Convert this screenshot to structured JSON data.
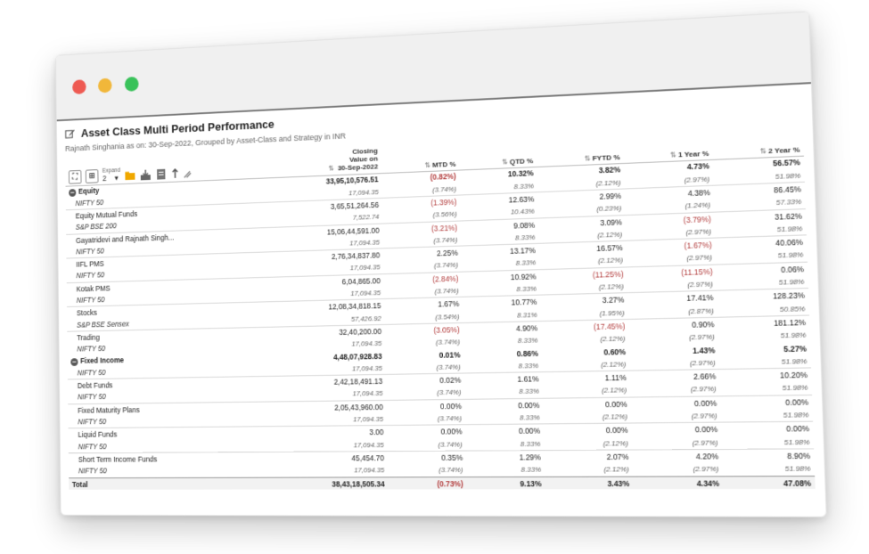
{
  "report": {
    "title": "Asset Class Multi Period Performance",
    "subtitle": "Rajnath Singhania as on: 30-Sep-2022, Grouped by Asset-Class and Strategy in INR"
  },
  "toolbar": {
    "expand_label": "Expand",
    "expand_value": "2"
  },
  "columns": {
    "closing": [
      "Closing",
      "Value on",
      "30-Sep-2022"
    ],
    "mtd": "MTD %",
    "qtd": "QTD %",
    "fytd": "FYTD %",
    "y1": "1 Year %",
    "y2": "2 Year %"
  },
  "rows": [
    {
      "kind": "group",
      "label": "Equity",
      "value": "33,95,10,576.51",
      "mtd": "(0.82%)",
      "qtd": "10.32%",
      "fytd": "3.82%",
      "y1": "4.73%",
      "y2": "56.57%"
    },
    {
      "kind": "bench",
      "label": "NIFTY 50",
      "value": "17,094.35",
      "mtd": "(3.74%)",
      "qtd": "8.33%",
      "fytd": "(2.12%)",
      "y1": "(2.97%)",
      "y2": "51.98%"
    },
    {
      "kind": "primary",
      "label": "Equity Mutual Funds",
      "value": "3,65,51,264.56",
      "mtd": "(1.39%)",
      "qtd": "12.63%",
      "fytd": "2.99%",
      "y1": "4.38%",
      "y2": "86.45%"
    },
    {
      "kind": "bench",
      "label": "S&P BSE 200",
      "value": "7,522.74",
      "mtd": "(3.56%)",
      "qtd": "10.43%",
      "fytd": "(0.23%)",
      "y1": "(1.24%)",
      "y2": "57.33%"
    },
    {
      "kind": "primary",
      "label": "Gayatridevi and Rajnath Singh...",
      "value": "15,06,44,591.00",
      "mtd": "(3.21%)",
      "qtd": "9.08%",
      "fytd": "3.09%",
      "y1": "(3.79%)",
      "y2": "31.62%"
    },
    {
      "kind": "bench",
      "label": "NIFTY 50",
      "value": "17,094.35",
      "mtd": "(3.74%)",
      "qtd": "8.33%",
      "fytd": "(2.12%)",
      "y1": "(2.97%)",
      "y2": "51.98%"
    },
    {
      "kind": "primary",
      "label": "IIFL PMS",
      "value": "2,76,34,837.80",
      "mtd": "2.25%",
      "qtd": "13.17%",
      "fytd": "16.57%",
      "y1": "(1.67%)",
      "y2": "40.06%"
    },
    {
      "kind": "bench",
      "label": "NIFTY 50",
      "value": "17,094.35",
      "mtd": "(3.74%)",
      "qtd": "8.33%",
      "fytd": "(2.12%)",
      "y1": "(2.97%)",
      "y2": "51.98%"
    },
    {
      "kind": "primary",
      "label": "Kotak PMS",
      "value": "6,04,865.00",
      "mtd": "(2.84%)",
      "qtd": "10.92%",
      "fytd": "(11.25%)",
      "y1": "(11.15%)",
      "y2": "0.06%"
    },
    {
      "kind": "bench",
      "label": "NIFTY 50",
      "value": "17,094.35",
      "mtd": "(3.74%)",
      "qtd": "8.33%",
      "fytd": "(2.12%)",
      "y1": "(2.97%)",
      "y2": "51.98%"
    },
    {
      "kind": "primary",
      "label": "Stocks",
      "value": "12,08,34,818.15",
      "mtd": "1.67%",
      "qtd": "10.77%",
      "fytd": "3.27%",
      "y1": "17.41%",
      "y2": "128.23%"
    },
    {
      "kind": "bench",
      "label": "S&P BSE Sensex",
      "value": "57,426.92",
      "mtd": "(3.54%)",
      "qtd": "8.31%",
      "fytd": "(1.95%)",
      "y1": "(2.87%)",
      "y2": "50.85%"
    },
    {
      "kind": "primary",
      "label": "Trading",
      "value": "32,40,200.00",
      "mtd": "(3.05%)",
      "qtd": "4.90%",
      "fytd": "(17.45%)",
      "y1": "0.90%",
      "y2": "181.12%"
    },
    {
      "kind": "bench",
      "label": "NIFTY 50",
      "value": "17,094.35",
      "mtd": "(3.74%)",
      "qtd": "8.33%",
      "fytd": "(2.12%)",
      "y1": "(2.97%)",
      "y2": "51.98%"
    },
    {
      "kind": "group",
      "label": "Fixed Income",
      "value": "4,48,07,928.83",
      "mtd": "0.01%",
      "qtd": "0.86%",
      "fytd": "0.60%",
      "y1": "1.43%",
      "y2": "5.27%"
    },
    {
      "kind": "bench",
      "label": "NIFTY 50",
      "value": "17,094.35",
      "mtd": "(3.74%)",
      "qtd": "8.33%",
      "fytd": "(2.12%)",
      "y1": "(2.97%)",
      "y2": "51.98%"
    },
    {
      "kind": "primary",
      "label": "Debt Funds",
      "value": "2,42,18,491.13",
      "mtd": "0.02%",
      "qtd": "1.61%",
      "fytd": "1.11%",
      "y1": "2.66%",
      "y2": "10.20%"
    },
    {
      "kind": "bench",
      "label": "NIFTY 50",
      "value": "17,094.35",
      "mtd": "(3.74%)",
      "qtd": "8.33%",
      "fytd": "(2.12%)",
      "y1": "(2.97%)",
      "y2": "51.98%"
    },
    {
      "kind": "primary",
      "label": "Fixed Maturity Plans",
      "value": "2,05,43,960.00",
      "mtd": "0.00%",
      "qtd": "0.00%",
      "fytd": "0.00%",
      "y1": "0.00%",
      "y2": "0.00%"
    },
    {
      "kind": "bench",
      "label": "NIFTY 50",
      "value": "17,094.35",
      "mtd": "(3.74%)",
      "qtd": "8.33%",
      "fytd": "(2.12%)",
      "y1": "(2.97%)",
      "y2": "51.98%"
    },
    {
      "kind": "primary",
      "label": "Liquid Funds",
      "value": "3.00",
      "mtd": "0.00%",
      "qtd": "0.00%",
      "fytd": "0.00%",
      "y1": "0.00%",
      "y2": "0.00%"
    },
    {
      "kind": "bench",
      "label": "NIFTY 50",
      "value": "17,094.35",
      "mtd": "(3.74%)",
      "qtd": "8.33%",
      "fytd": "(2.12%)",
      "y1": "(2.97%)",
      "y2": "51.98%"
    },
    {
      "kind": "primary",
      "label": "Short Term Income Funds",
      "value": "45,454.70",
      "mtd": "0.35%",
      "qtd": "1.29%",
      "fytd": "2.07%",
      "y1": "4.20%",
      "y2": "8.90%"
    },
    {
      "kind": "bench",
      "label": "NIFTY 50",
      "value": "17,094.35",
      "mtd": "(3.74%)",
      "qtd": "8.33%",
      "fytd": "(2.12%)",
      "y1": "(2.97%)",
      "y2": "51.98%"
    },
    {
      "kind": "total",
      "label": "Total",
      "value": "38,43,18,505.34",
      "mtd": "(0.73%)",
      "qtd": "9.13%",
      "fytd": "3.43%",
      "y1": "4.34%",
      "y2": "47.08%"
    }
  ],
  "colors": {
    "negative": "#b23b3b",
    "traffic_red": "#ee5a52",
    "traffic_yellow": "#f1b73a",
    "traffic_green": "#39c25a"
  }
}
